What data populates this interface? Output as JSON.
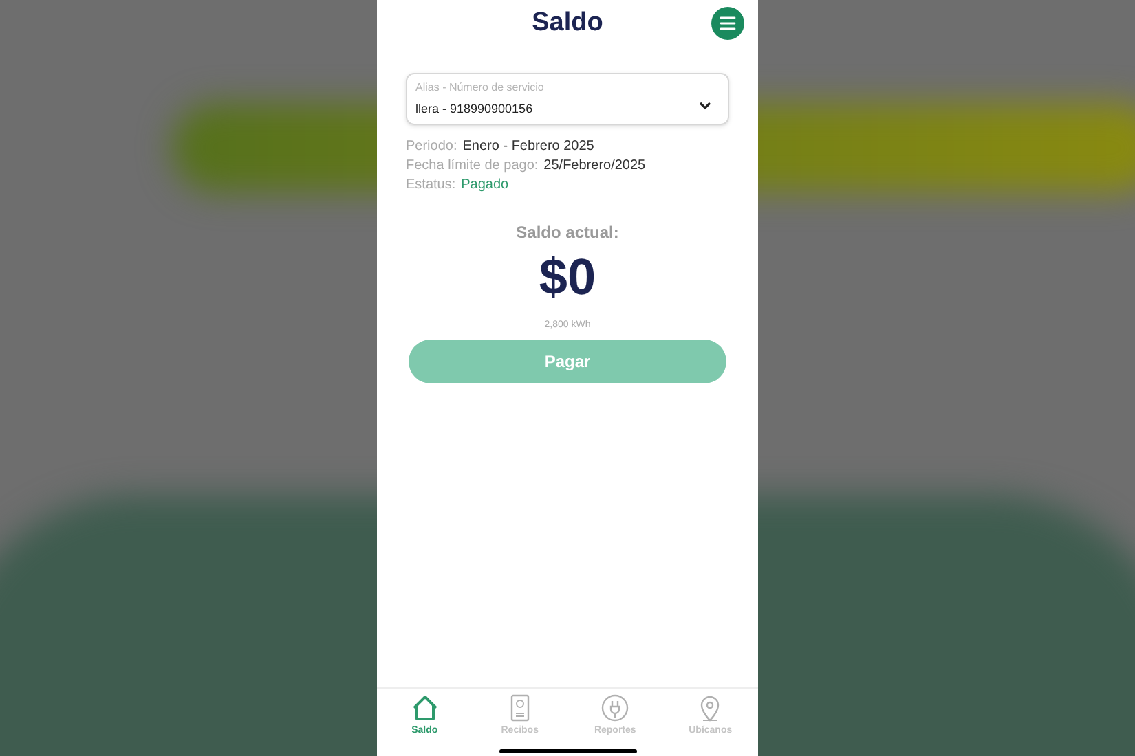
{
  "header": {
    "title": "Saldo"
  },
  "service_select": {
    "label": "Alias - Número de servicio",
    "value": "llera - 918990900156"
  },
  "details": [
    {
      "label": "Periodo:",
      "value": "Enero - Febrero 2025",
      "kind": "plain"
    },
    {
      "label": "Fecha límite de pago:",
      "value": "25/Febrero/2025",
      "kind": "plain"
    },
    {
      "label": "Estatus:",
      "value": "Pagado",
      "kind": "status"
    }
  ],
  "balance": {
    "label": "Saldo actual:",
    "amount": "$0",
    "consumption": "2,800 kWh"
  },
  "pay_button": {
    "label": "Pagar",
    "disabled": true
  },
  "tab_bar": [
    {
      "label": "Saldo",
      "kind": "home",
      "selected": true
    },
    {
      "label": "Recibos",
      "kind": "receipt",
      "selected": false
    },
    {
      "label": "Reportes",
      "kind": "plug",
      "selected": false
    },
    {
      "label": "Ubícanos",
      "kind": "pin",
      "selected": false
    }
  ]
}
